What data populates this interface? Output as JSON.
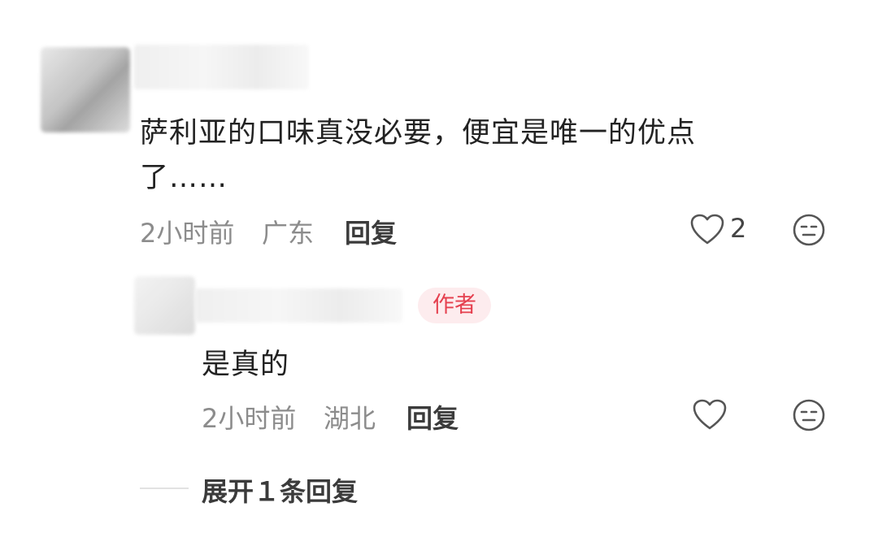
{
  "comment": {
    "text_line1": "萨利亚的口味真没必要，便宜是唯一的优点",
    "text_line2": "了……",
    "time": "2小时前",
    "location": "广东",
    "reply_label": "回复",
    "like_count": "2"
  },
  "reply": {
    "author_badge": "作者",
    "text": "是真的",
    "time": "2小时前",
    "location": "湖北",
    "reply_label": "回复"
  },
  "expand": {
    "label": "展开１条回复"
  },
  "icons": {
    "like": "heart-outline-icon",
    "dislike": "neutral-face-icon"
  },
  "colors": {
    "text": "#222222",
    "meta": "#8c8c8c",
    "badge_bg": "#fdecee",
    "badge_text": "#e5404f"
  }
}
